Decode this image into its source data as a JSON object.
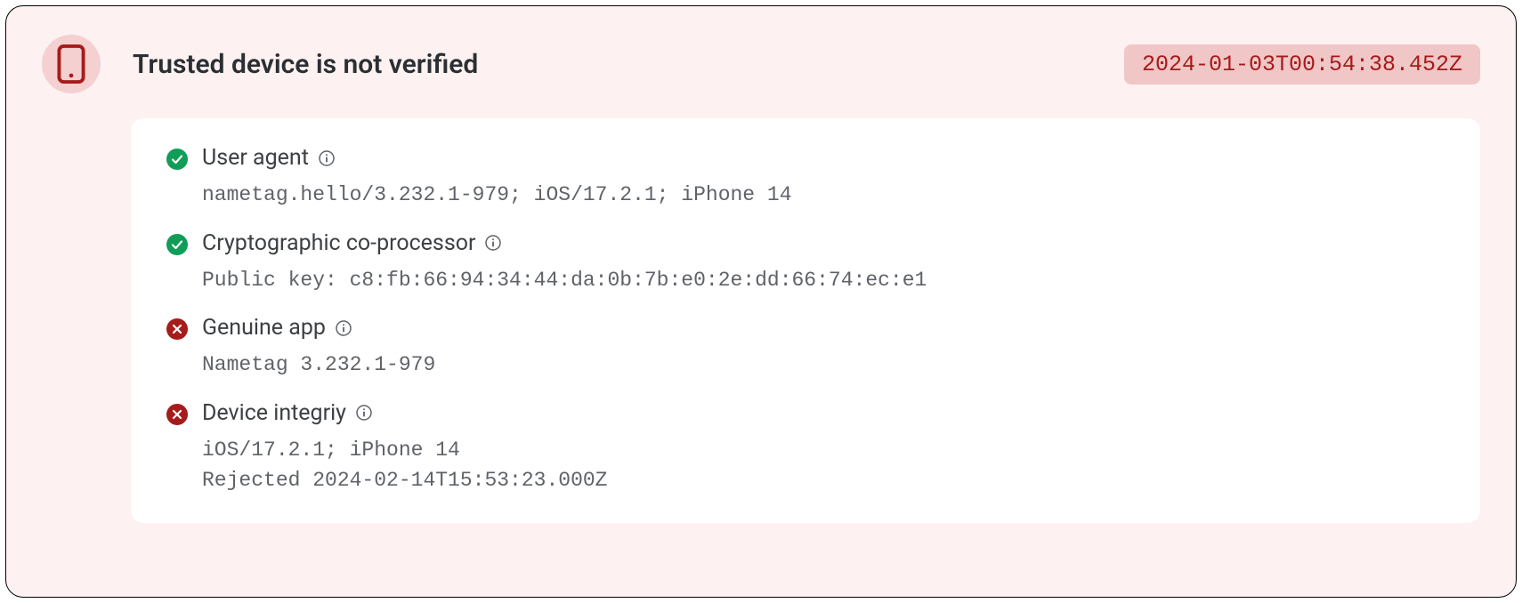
{
  "card": {
    "title": "Trusted device is not verified",
    "timestamp": "2024-01-03T00:54:38.452Z"
  },
  "checks": [
    {
      "status": "ok",
      "label": "User agent",
      "value": "nametag.hello/3.232.1-979; iOS/17.2.1; iPhone 14"
    },
    {
      "status": "ok",
      "label": "Cryptographic co-processor",
      "value": "Public key: c8:fb:66:94:34:44:da:0b:7b:e0:2e:dd:66:74:ec:e1"
    },
    {
      "status": "fail",
      "label": "Genuine app",
      "value": "Nametag 3.232.1-979"
    },
    {
      "status": "fail",
      "label": "Device integriy",
      "value": "iOS/17.2.1; iPhone 14\nRejected 2024-02-14T15:53:23.000Z"
    }
  ]
}
